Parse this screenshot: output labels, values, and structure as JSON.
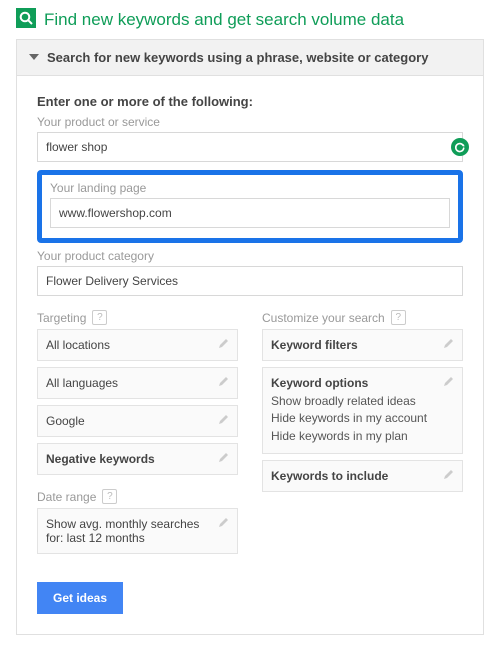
{
  "title": "Find new keywords and get search volume data",
  "accordion_title": "Search for new keywords using a phrase, website or category",
  "lead": "Enter one or more of the following:",
  "labels": {
    "product_or_service": "Your product or service",
    "landing_page": "Your landing page",
    "product_category": "Your product category",
    "targeting": "Targeting",
    "customize": "Customize your search",
    "date_range": "Date range"
  },
  "inputs": {
    "product_or_service": "flower shop",
    "landing_page": "www.flowershop.com",
    "product_category": "Flower Delivery Services"
  },
  "targeting": {
    "locations": "All locations",
    "languages": "All languages",
    "network": "Google",
    "negative": "Negative keywords"
  },
  "customize": {
    "filters": "Keyword filters",
    "options_title": "Keyword options",
    "options_lines": {
      "l1": "Show broadly related ideas",
      "l2": "Hide keywords in my account",
      "l3": "Hide keywords in my plan"
    },
    "include": "Keywords to include"
  },
  "date_range_text": {
    "l1": "Show avg. monthly searches",
    "l2": "for: last 12 months"
  },
  "cta": "Get ideas",
  "help_glyph": "?"
}
